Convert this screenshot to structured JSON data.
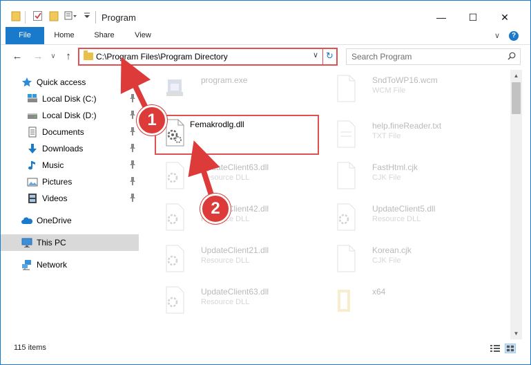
{
  "window": {
    "title": "Program",
    "controls": {
      "minimize": "—",
      "maximize": "☐",
      "close": "✕"
    }
  },
  "ribbon": {
    "tabs": [
      {
        "label": "File",
        "active": true
      },
      {
        "label": "Home"
      },
      {
        "label": "Share"
      },
      {
        "label": "View"
      }
    ],
    "expand_glyph": "∨",
    "help_glyph": "?"
  },
  "nav": {
    "back": "←",
    "forward": "→",
    "recent": "∨",
    "up": "↑",
    "address": "C:\\Program Files\\Program Directory",
    "address_dropdown": "∨",
    "refresh": "↻",
    "search_placeholder": "Search Program"
  },
  "sidebar": {
    "items": [
      {
        "label": "Quick access",
        "icon": "star-icon"
      },
      {
        "label": "Local Disk (C:)",
        "icon": "drive-icon",
        "pinned": true
      },
      {
        "label": "Local Disk (D:)",
        "icon": "drive-icon",
        "pinned": true
      },
      {
        "label": "Documents",
        "icon": "documents-icon",
        "pinned": true
      },
      {
        "label": "Downloads",
        "icon": "download-icon",
        "pinned": true
      },
      {
        "label": "Music",
        "icon": "music-icon",
        "pinned": true
      },
      {
        "label": "Pictures",
        "icon": "pictures-icon",
        "pinned": true
      },
      {
        "label": "Videos",
        "icon": "videos-icon",
        "pinned": true
      },
      {
        "label": "OneDrive",
        "icon": "cloud-icon"
      },
      {
        "label": "This PC",
        "icon": "monitor-icon",
        "selected": true
      },
      {
        "label": "Network",
        "icon": "network-icon"
      }
    ]
  },
  "files": {
    "left": [
      {
        "name": "program.exe",
        "type": ""
      },
      {
        "name": "Femakrodlg.dll",
        "type": ""
      },
      {
        "name": "UpdateClient63.dll",
        "type": "Resource DLL"
      },
      {
        "name": "UpdateClient42.dll",
        "type": "Resource DLL"
      },
      {
        "name": "UpdateClient21.dll",
        "type": "Resource DLL"
      },
      {
        "name": "UpdateClient63.dll",
        "type": "Resource DLL"
      }
    ],
    "right": [
      {
        "name": "SndToWP16.wcm",
        "type": "WCM File"
      },
      {
        "name": "help.fineReader.txt",
        "type": "TXT File"
      },
      {
        "name": "FastHtml.cjk",
        "type": "CJK File"
      },
      {
        "name": "UpdateClient5.dll",
        "type": "Resource DLL"
      },
      {
        "name": "Korean.cjk",
        "type": "CJK File"
      },
      {
        "name": "x64",
        "type": ""
      }
    ]
  },
  "status": {
    "items_count": "115 items"
  },
  "annotations": {
    "step1": "1",
    "step2": "2"
  },
  "colors": {
    "accent": "#1979ca",
    "highlight": "#e05050",
    "badge": "#dd3a3a"
  }
}
